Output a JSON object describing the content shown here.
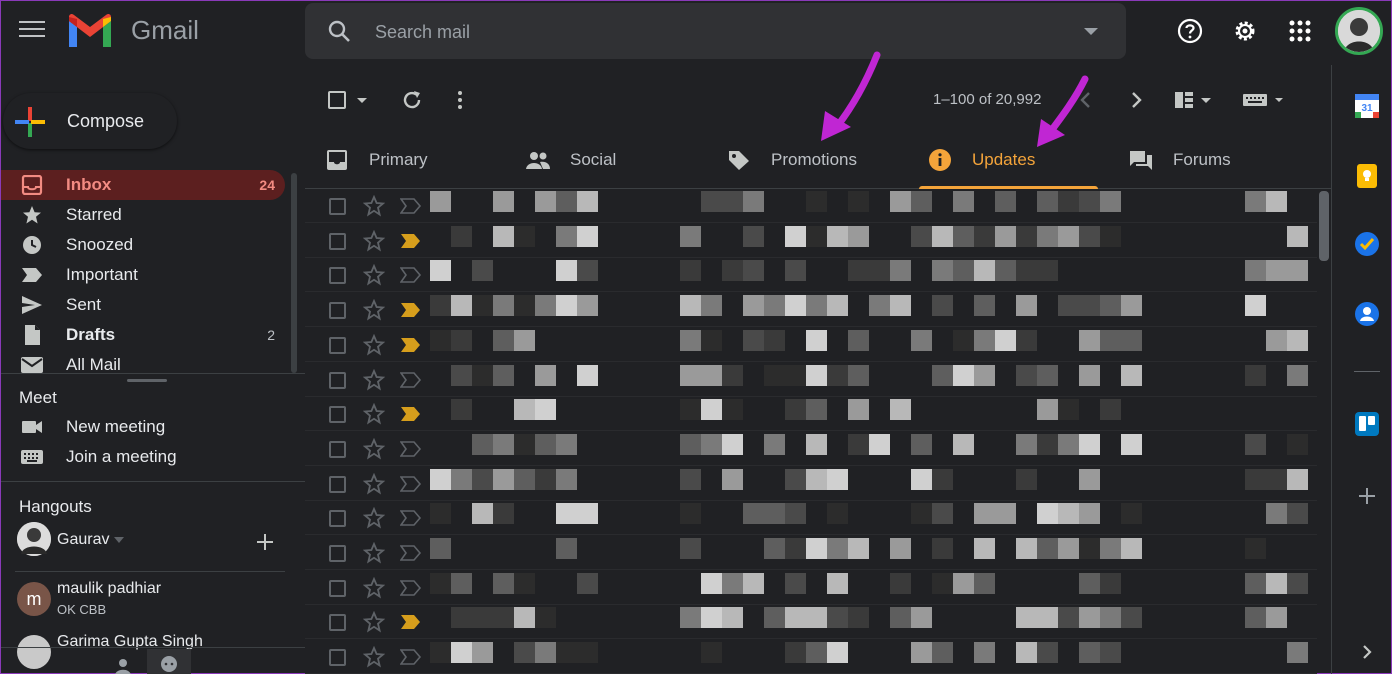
{
  "app": {
    "brand": "Gmail"
  },
  "search": {
    "placeholder": "Search mail"
  },
  "sidebar": {
    "compose_label": "Compose",
    "items": [
      {
        "label": "Inbox",
        "count": "24"
      },
      {
        "label": "Starred",
        "count": ""
      },
      {
        "label": "Snoozed",
        "count": ""
      },
      {
        "label": "Important",
        "count": ""
      },
      {
        "label": "Sent",
        "count": ""
      },
      {
        "label": "Drafts",
        "count": "2"
      },
      {
        "label": "All Mail",
        "count": ""
      }
    ],
    "meet": {
      "title": "Meet",
      "new_meeting": "New meeting",
      "join_meeting": "Join a meeting"
    },
    "hangouts": {
      "title": "Hangouts",
      "self_name": "Gaurav",
      "contacts": [
        {
          "initial": "m",
          "name": "maulik padhiar",
          "status": "OK CBB"
        },
        {
          "initial": "",
          "name": "Garima Gupta Singh",
          "status": ""
        }
      ]
    }
  },
  "toolbar": {
    "pagination": "1–100 of 20,992"
  },
  "tabs": [
    {
      "label": "Primary"
    },
    {
      "label": "Social"
    },
    {
      "label": "Promotions"
    },
    {
      "label": "Updates"
    },
    {
      "label": "Forums"
    }
  ],
  "colors": {
    "accent": "#f4a43a",
    "inbox_active": "#f28b82",
    "annotation_arrow": "#c026d3"
  },
  "emails": [
    {
      "starred": false,
      "important": false
    },
    {
      "starred": false,
      "important": true
    },
    {
      "starred": false,
      "important": false
    },
    {
      "starred": false,
      "important": true
    },
    {
      "starred": false,
      "important": true
    },
    {
      "starred": false,
      "important": false
    },
    {
      "starred": false,
      "important": true
    },
    {
      "starred": false,
      "important": false
    },
    {
      "starred": false,
      "important": false
    },
    {
      "starred": false,
      "important": false
    },
    {
      "starred": false,
      "important": false
    },
    {
      "starred": false,
      "important": false
    },
    {
      "starred": false,
      "important": true
    },
    {
      "starred": false,
      "important": false
    }
  ]
}
